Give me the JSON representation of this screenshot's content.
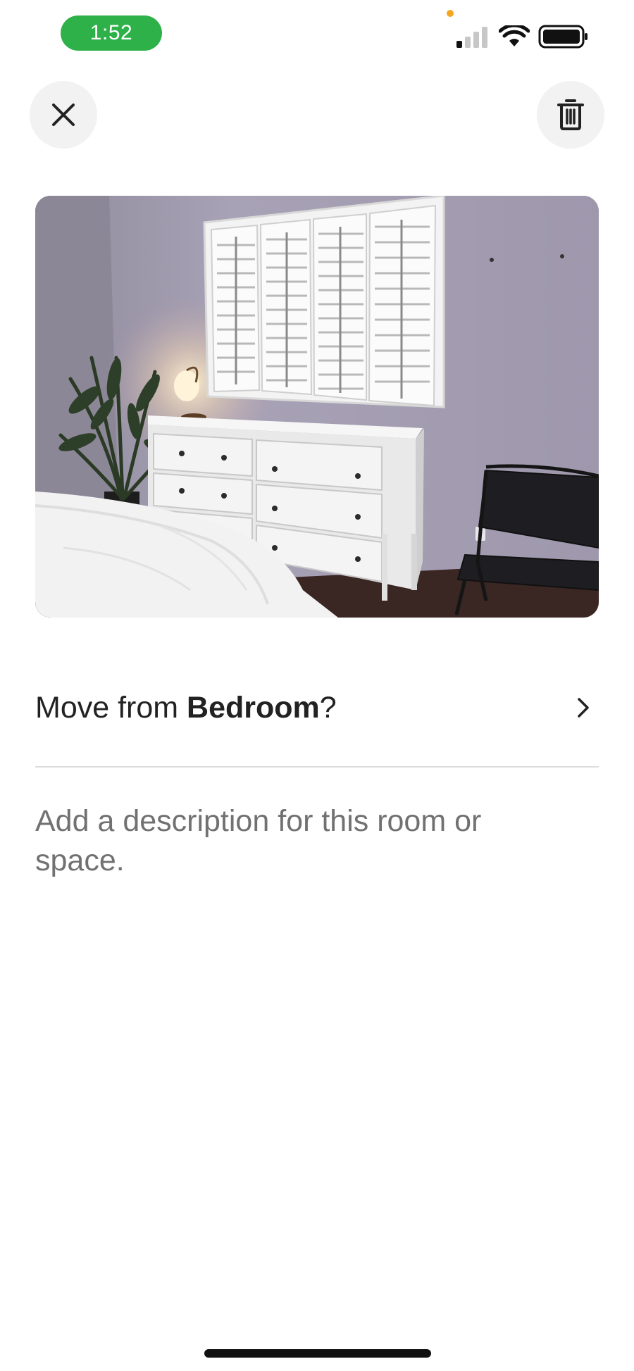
{
  "status_bar": {
    "time": "1:52",
    "time_pill_color": "#2fb14a",
    "icons": [
      "signal-icon",
      "wifi-icon",
      "battery-icon"
    ]
  },
  "toolbar": {
    "close_icon": "close-icon",
    "delete_icon": "trash-icon"
  },
  "photo": {
    "subject": "bedroom-photo"
  },
  "move_row": {
    "prefix": "Move from ",
    "room": "Bedroom",
    "suffix": "?",
    "chevron_icon": "chevron-right-icon"
  },
  "description": {
    "placeholder": "Add a description for this room or space."
  },
  "colors": {
    "text_primary": "#222222",
    "text_secondary": "#717171",
    "button_bg": "#f2f2f2",
    "divider": "#dddddd"
  }
}
